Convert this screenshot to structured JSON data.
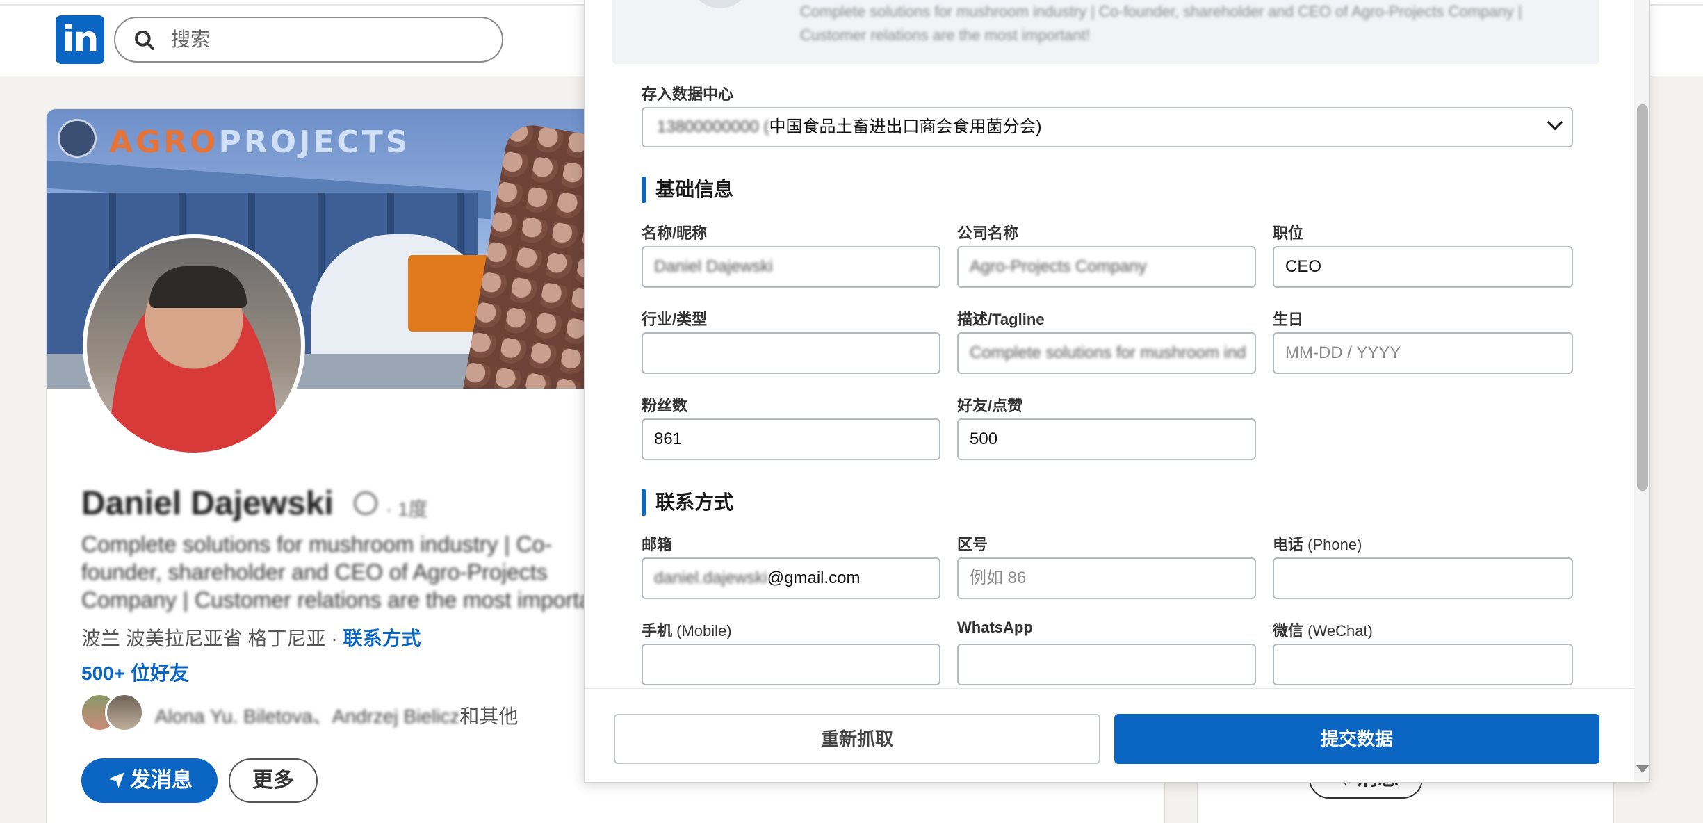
{
  "topbar": {
    "logo_text": "in",
    "search_placeholder": "搜索"
  },
  "profile": {
    "banner_logo_part1": "AGRO",
    "banner_logo_part2": "PROJECTS",
    "name": "Daniel Dajewski",
    "degree": "· 1度",
    "headline": "Complete solutions for mushroom industry | Co-founder, shareholder and CEO of Agro-Projects Company | Customer relations are the most important!",
    "location_prefix": "波兰 波美拉尼亚省 格丁尼亚 · ",
    "contact_link": "联系方式",
    "connections": "500+ 位好友",
    "mutual_names": "Alona Yu. Biletova、Andrzej Bielicz",
    "mutual_suffix": "和其他",
    "message_button": "发消息",
    "more_button": "更多"
  },
  "side_card": {
    "message_button": "消息"
  },
  "panel": {
    "scrape_preview_text": "Complete solutions for mushroom industry | Co-founder, shareholder and CEO of Agro-Projects Company | Customer relations are the most important!",
    "datacenter_label": "存入数据中心",
    "datacenter_value_blurred": "13800000000 (",
    "datacenter_value": "中国食品土畜进出口商会食用菌分会)",
    "basic_section": "基础信息",
    "fields": {
      "name_label": "名称/昵称",
      "name_value": "Daniel Dajewski",
      "company_label": "公司名称",
      "company_value": "Agro-Projects Company",
      "position_label": "职位",
      "position_value": "CEO",
      "industry_label": "行业/类型",
      "industry_value": "",
      "tagline_label": "描述/Tagline",
      "tagline_value": "Complete solutions for mushroom ind",
      "birthday_label": "生日",
      "birthday_placeholder": "MM-DD / YYYY",
      "followers_label": "粉丝数",
      "followers_value": "861",
      "friends_label": "好友/点赞",
      "friends_value": "500"
    },
    "contact_section": "联系方式",
    "contact": {
      "email_label": "邮箱",
      "email_value_blurred": "daniel.dajewski",
      "email_value_domain": "@gmail.com",
      "area_code_label": "区号",
      "area_code_placeholder": "例如 86",
      "phone_label": "电话",
      "phone_label_paren": "(Phone)",
      "mobile_label": "手机",
      "mobile_label_paren": "(Mobile)",
      "whatsapp_label": "WhatsApp",
      "wechat_label": "微信",
      "wechat_label_paren": "(WeChat)"
    },
    "footer": {
      "refetch_button": "重新抓取",
      "submit_button": "提交数据"
    }
  },
  "colors": {
    "brand_blue": "#0a66c2",
    "banner_orange": "#e4743a"
  }
}
